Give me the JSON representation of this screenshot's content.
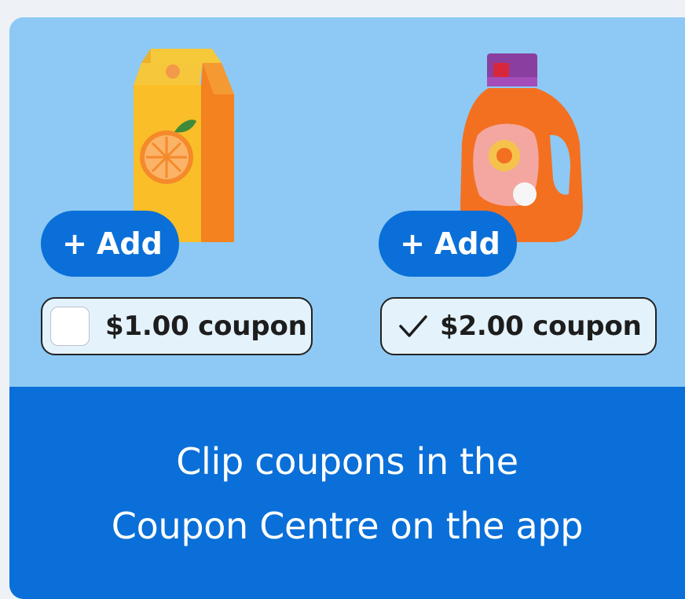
{
  "products": [
    {
      "icon": "juice-carton-icon",
      "add_label": "Add",
      "add_plus": "+",
      "coupon_label": "$1.00 coupon",
      "coupon_clipped": false
    },
    {
      "icon": "detergent-bottle-icon",
      "add_label": "Add",
      "add_plus": "+",
      "coupon_label": "$2.00 coupon",
      "coupon_clipped": true
    }
  ],
  "banner": {
    "line1": "Clip coupons in the",
    "line2": "Coupon Centre on the app"
  },
  "colors": {
    "brand_blue": "#0a6fd8",
    "promo_bg": "#8dc9f4",
    "page_bg": "#eef2f6"
  }
}
